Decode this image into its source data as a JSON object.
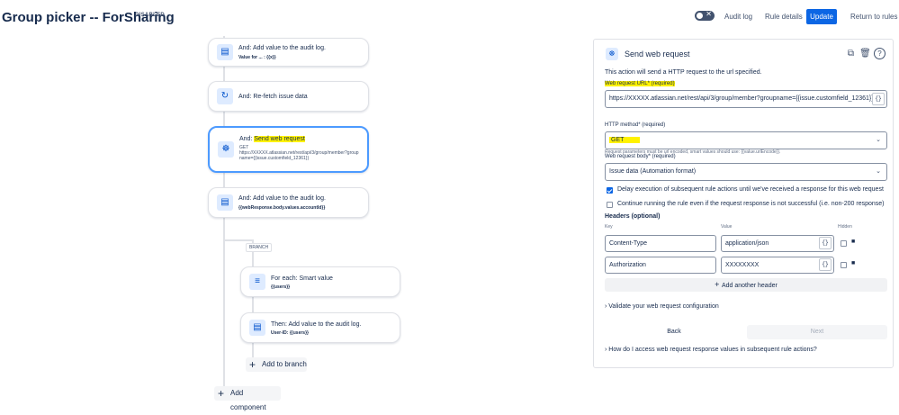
{
  "header": {
    "title": "Group picker -- ForSharing",
    "status": "DISABLED",
    "toggle_symbol": "✕",
    "audit_log": "Audit log",
    "rule_details": "Rule details",
    "update": "Update",
    "return": "Return to rules"
  },
  "flow": {
    "card1": {
      "title": "And: Add value to the audit log.",
      "sub": "Value for ... : {{x}}",
      "icon": "document-icon"
    },
    "card2": {
      "title": "And: Re-fetch issue data",
      "icon": "refresh-icon"
    },
    "card3": {
      "prefix": "And: ",
      "highlight": "Send web request",
      "method": "GET",
      "url": "https://XXXXX.atlassian.net/rest/api/3/group/member?groupname={{issue.customfield_12361}}",
      "icon": "webhook-icon"
    },
    "card4": {
      "title": "And: Add value to the audit log.",
      "sub": "{{webResponse.body.values.accountId}}",
      "icon": "document-icon"
    },
    "branch_label": "BRANCH",
    "card5": {
      "title": "For each: Smart value",
      "sub": "{{users}}",
      "icon": "list-icon"
    },
    "card6": {
      "title": "Then: Add value to the audit log.",
      "sub": "User-ID: {{users}}",
      "icon": "document-icon"
    },
    "add_to_branch": "Add to branch",
    "add_component": "Add component"
  },
  "panel": {
    "title": "Send web request",
    "description": "This action will send a HTTP request to the url specified.",
    "url_label": "Web request URL* (required)",
    "url_value": "https://XXXXX.atlassian.net/rest/api/3/group/member?groupname={{issue.customfield_12361}}",
    "url_help": "Request parameters must be url encoded, smart values should use: {{value.urlEncode}}.",
    "method_label": "HTTP method* (required)",
    "method_value": "GET",
    "body_label": "Web request body* (required)",
    "body_value": "Issue data (Automation format)",
    "delay_label": "Delay execution of subsequent rule actions until we've received a response for this web request",
    "delay_checked": true,
    "continue_label": "Continue running the rule even if the request response is not successful (i.e. non-200 response)",
    "continue_checked": false,
    "headers_title": "Headers (optional)",
    "col_key": "Key",
    "col_value": "Value",
    "col_hidden": "Hidden",
    "headers": [
      {
        "key": "Content-Type",
        "value": "application/json"
      },
      {
        "key": "Authorization",
        "value": "XXXXXXXX"
      }
    ],
    "add_header": "Add another header",
    "validate": "Validate your web request configuration",
    "back": "Back",
    "next": "Next",
    "faq": "How do I access web request response values in subsequent rule actions?"
  }
}
